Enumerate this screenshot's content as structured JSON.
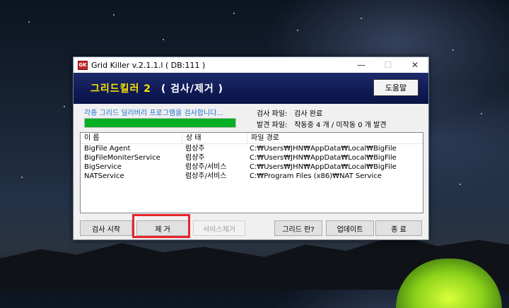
{
  "window": {
    "title": "Grid Killer v.2.1.1.l ( DB:111 )",
    "app_icon_text": "GK",
    "controls": {
      "minimize": "—",
      "maximize": "☐",
      "close": "✕"
    }
  },
  "banner": {
    "app_name": "그리드킬러 2",
    "subtitle": "( 검사/제거 )",
    "help_label": "도움말"
  },
  "status": {
    "scan_message": "각종 그리드 딜리버리 프로그램을 검사합니다...",
    "progress_percent": 100,
    "scan_file_label": "검사 파일:",
    "scan_file_value": "검사 완료",
    "found_file_label": "발견 파일:",
    "found_file_value": "작동중 4 개 / 미작동 0 개 발견"
  },
  "list": {
    "headers": {
      "name": "이 름",
      "state": "상 태",
      "path": "파일 경로"
    },
    "rows": [
      {
        "name": "BigFile Agent",
        "state": "럼상주",
        "path": "C:₩Users₩JHN₩AppData₩Local₩BigFile"
      },
      {
        "name": "BigFileMoniterService",
        "state": "럼상주",
        "path": "C:₩Users₩JHN₩AppData₩Local₩BigFile"
      },
      {
        "name": "BigService",
        "state": "럼상주/서비스",
        "path": "C:₩Users₩JHN₩AppData₩Local₩BigFile"
      },
      {
        "name": "NATService",
        "state": "럼상주/서비스",
        "path": "C:₩Program Files (x86)₩NAT Service"
      }
    ]
  },
  "buttons": {
    "start_scan": "검사 시작",
    "remove": "제 거",
    "remove_service": "서비스제거",
    "grid_info": "그리드 란?",
    "update": "업데이트",
    "exit": "종 료"
  },
  "colors": {
    "banner": "#0f1a55",
    "app_name": "#ffe500",
    "progress": "#06b025",
    "scan_text": "#1f6fd0",
    "highlight": "#e8242a"
  }
}
